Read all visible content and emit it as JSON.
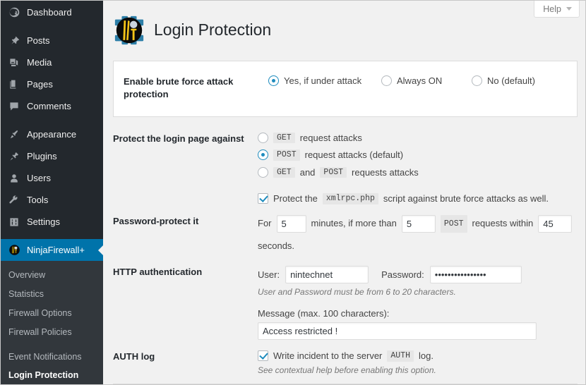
{
  "sidebar": {
    "items": [
      {
        "label": "Dashboard",
        "icon": "dashboard-icon",
        "active": false
      },
      {
        "label": "Posts",
        "icon": "pin-icon",
        "active": false
      },
      {
        "label": "Media",
        "icon": "media-icon",
        "active": false
      },
      {
        "label": "Pages",
        "icon": "pages-icon",
        "active": false
      },
      {
        "label": "Comments",
        "icon": "comments-icon",
        "active": false
      },
      {
        "label": "Appearance",
        "icon": "brush-icon",
        "active": false
      },
      {
        "label": "Plugins",
        "icon": "plug-icon",
        "active": false
      },
      {
        "label": "Users",
        "icon": "user-icon",
        "active": false
      },
      {
        "label": "Tools",
        "icon": "wrench-icon",
        "active": false
      },
      {
        "label": "Settings",
        "icon": "sliders-icon",
        "active": false
      },
      {
        "label": "NinjaFirewall+",
        "icon": "ninja-icon",
        "active": true
      }
    ],
    "submenu": [
      {
        "label": "Overview",
        "current": false
      },
      {
        "label": "Statistics",
        "current": false
      },
      {
        "label": "Firewall Options",
        "current": false
      },
      {
        "label": "Firewall Policies",
        "current": false
      },
      {
        "label": "Event Notifications",
        "current": false
      },
      {
        "label": "Login Protection",
        "current": true
      }
    ],
    "active_color": "#0073aa",
    "background_color": "#23282d",
    "submenu_background_color": "#32373c"
  },
  "header": {
    "title": "Login Protection",
    "logo_icon": "ninja-firewall-logo",
    "help_label": "Help",
    "help_caret_icon": "chevron-down-icon"
  },
  "form": {
    "enable": {
      "label": "Enable brute force attack protection",
      "options": [
        {
          "label": "Yes, if under attack",
          "selected": true
        },
        {
          "label": "Always ON",
          "selected": false
        },
        {
          "label": "No (default)",
          "selected": false
        }
      ]
    },
    "protect_against": {
      "label": "Protect the login page against",
      "options": [
        {
          "code1": "GET",
          "text_mid": "",
          "code2": "",
          "text_after": "request attacks",
          "selected": false
        },
        {
          "code1": "POST",
          "text_mid": "",
          "code2": "",
          "text_after": "request attacks (default)",
          "selected": true
        },
        {
          "code1": "GET",
          "text_mid": "and",
          "code2": "POST",
          "text_after": "requests attacks",
          "selected": false
        }
      ],
      "xmlrpc": {
        "checked": true,
        "text_before": "Protect the",
        "code": "xmlrpc.php",
        "text_after": "script against brute force attacks as well."
      }
    },
    "password_protect": {
      "label": "Password-protect it",
      "text_for": "For",
      "minutes_value": "5",
      "text_minutes": "minutes, if more than",
      "count_value": "5",
      "code_method": "POST",
      "text_requests": "requests within",
      "seconds_value": "45",
      "text_seconds": "seconds."
    },
    "http_auth": {
      "label": "HTTP authentication",
      "user_label": "User:",
      "user_value": "nintechnet",
      "password_label": "Password:",
      "password_value": "aaaaaaaaaaaaaaaa",
      "hint": "User and Password must be from 6 to 20 characters.",
      "message_label": "Message (max. 100 characters):",
      "message_value": "Access restricted !"
    },
    "auth_log": {
      "label": "AUTH log",
      "checked": true,
      "text_before": "Write incident to the server",
      "code": "AUTH",
      "text_after": "log.",
      "hint": "See contextual help before enabling this option."
    }
  }
}
